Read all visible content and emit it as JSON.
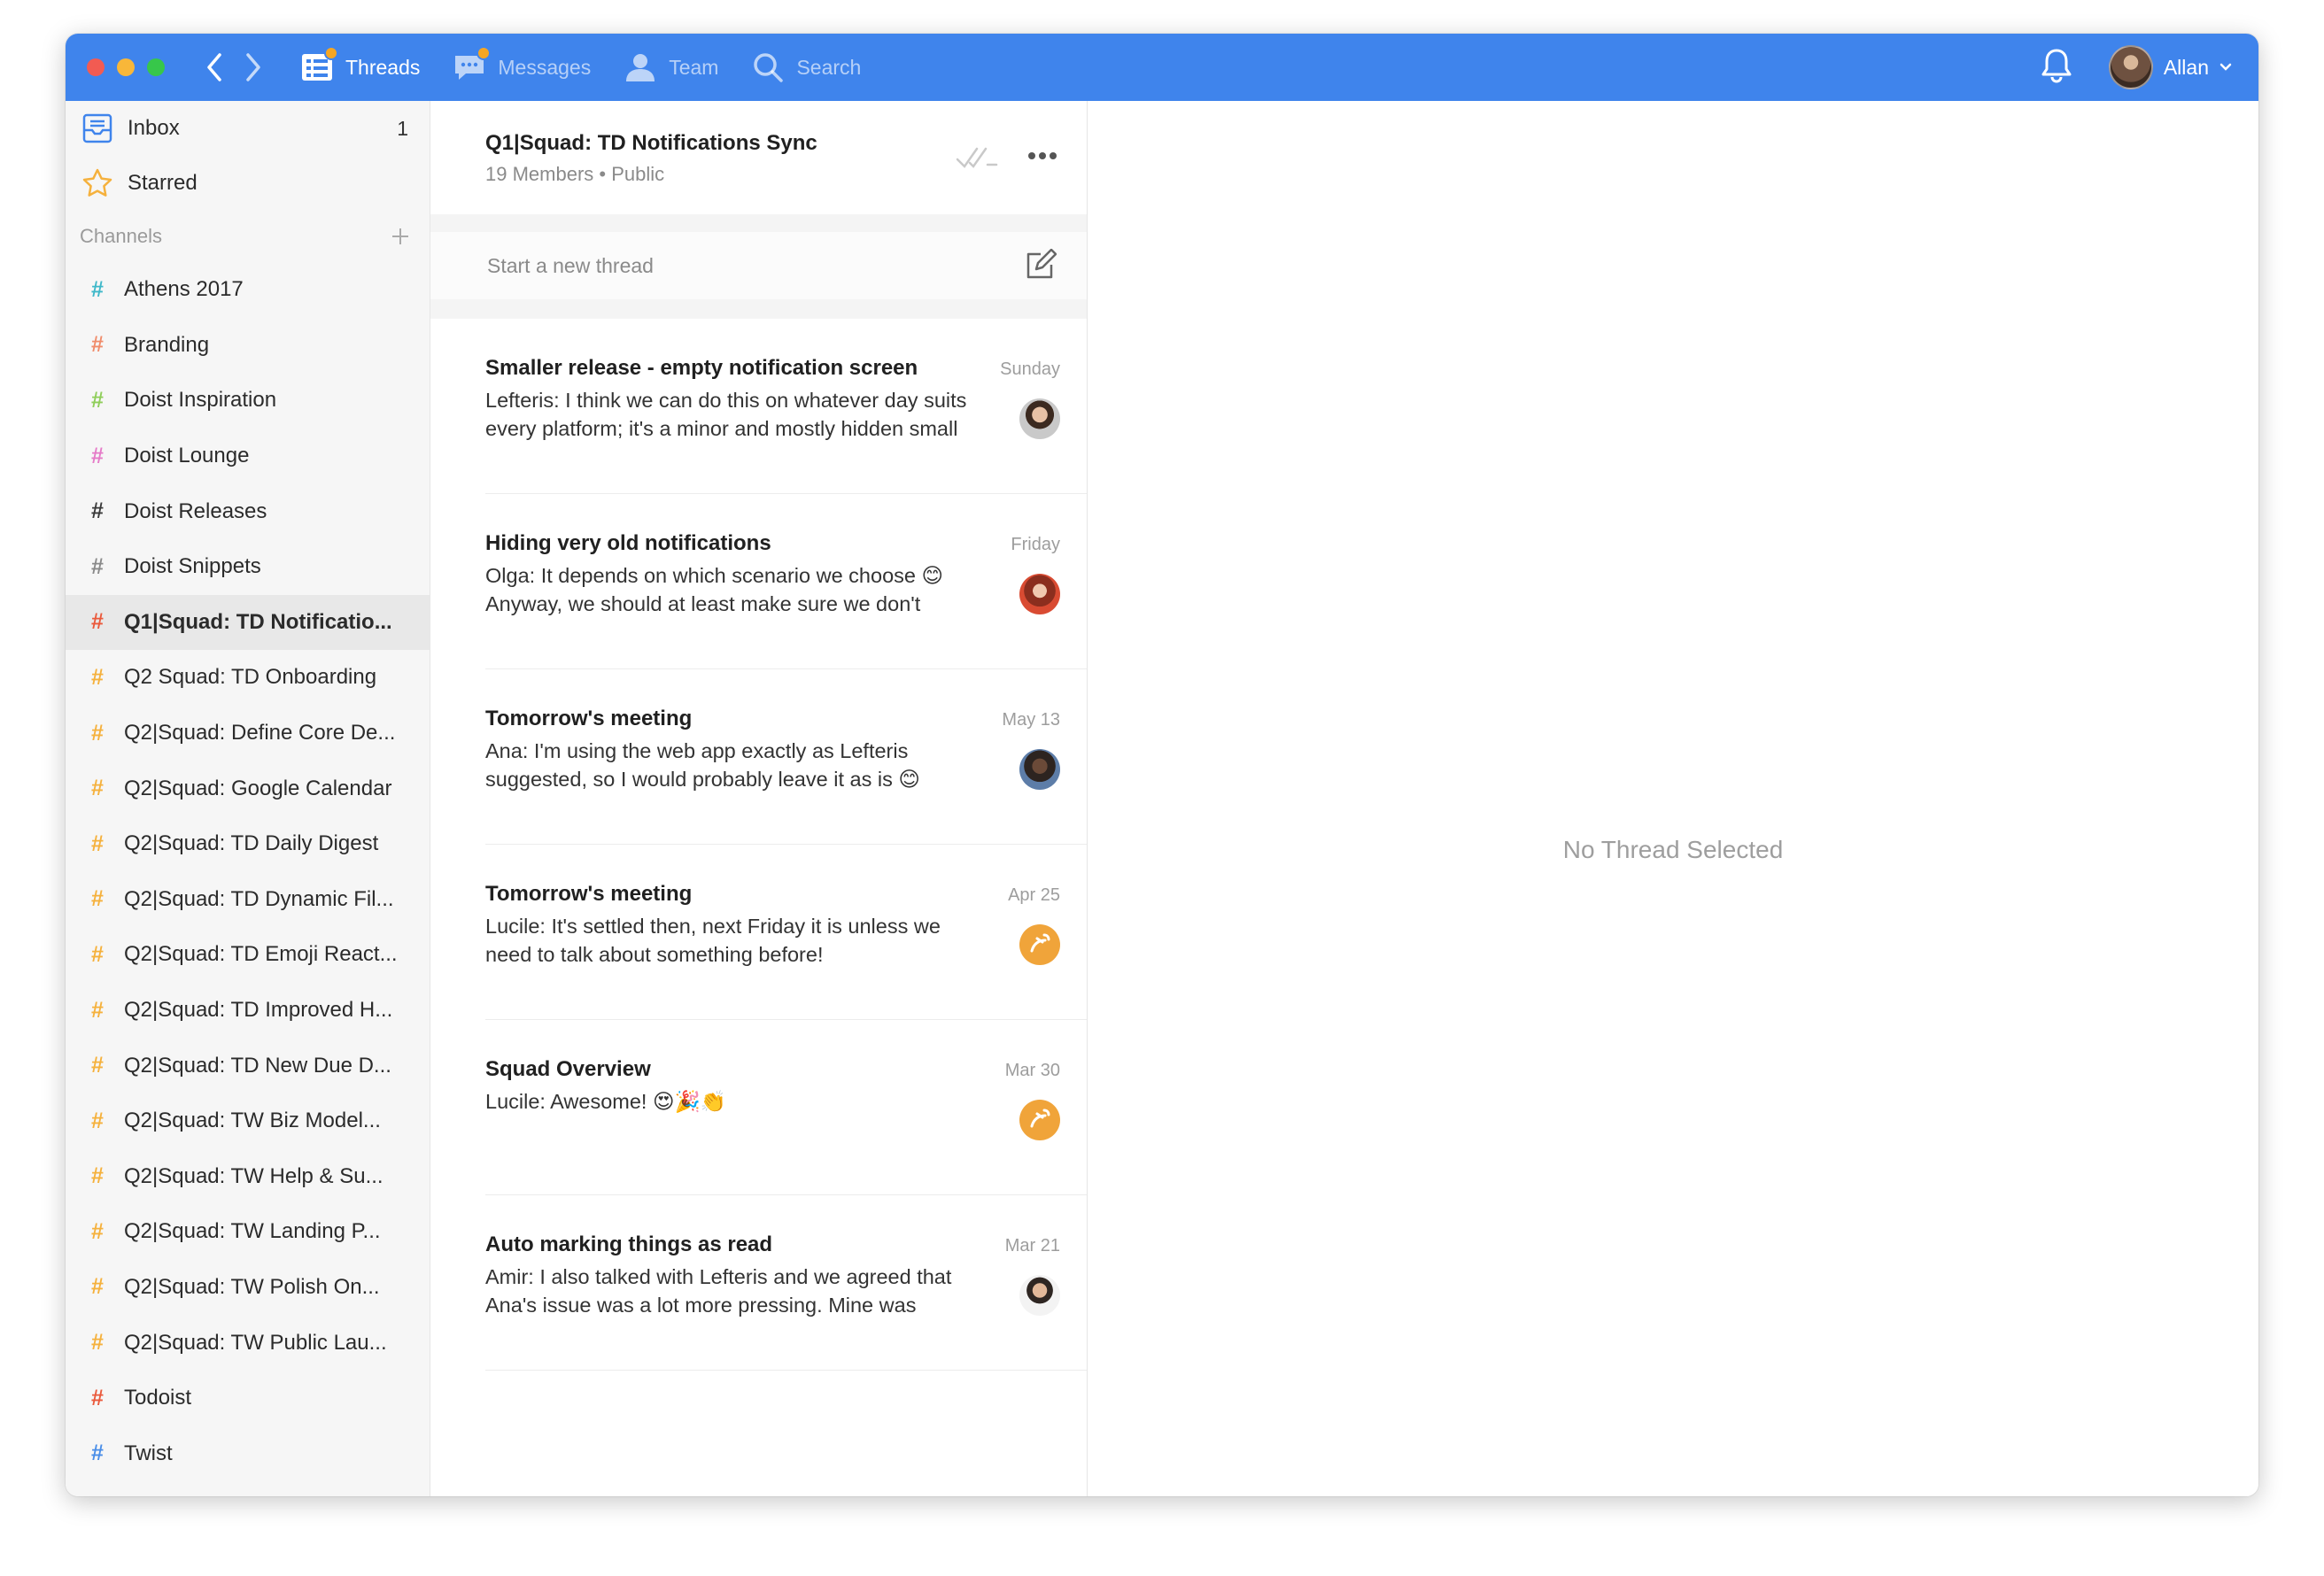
{
  "topbar": {
    "tabs": [
      {
        "label": "Threads",
        "icon": "threads-icon",
        "active": true,
        "badge": true
      },
      {
        "label": "Messages",
        "icon": "messages-icon",
        "active": false,
        "badge": true
      },
      {
        "label": "Team",
        "icon": "team-icon",
        "active": false,
        "badge": false
      },
      {
        "label": "Search",
        "icon": "search-icon",
        "active": false,
        "badge": false
      }
    ],
    "user": {
      "name": "Allan"
    },
    "color": "#3f84ec",
    "badge_color": "#f5a623"
  },
  "sidebar": {
    "inbox": {
      "label": "Inbox",
      "count": "1"
    },
    "starred": {
      "label": "Starred"
    },
    "channels_header": "Channels",
    "channels": [
      {
        "name": "Athens 2017",
        "color": "#3fb8c9"
      },
      {
        "name": "Branding",
        "color": "#f08c6b"
      },
      {
        "name": "Doist Inspiration",
        "color": "#8fce5a"
      },
      {
        "name": "Doist Lounge",
        "color": "#e57bc8"
      },
      {
        "name": "Doist Releases",
        "color": "#3a3a3a"
      },
      {
        "name": "Doist Snippets",
        "color": "#8a8a8a"
      },
      {
        "name": "Q1|Squad: TD Notificatio...",
        "color": "#ea5a3c",
        "selected": true
      },
      {
        "name": "Q2 Squad: TD Onboarding",
        "color": "#f5b13d"
      },
      {
        "name": "Q2|Squad: Define Core De...",
        "color": "#f5b13d"
      },
      {
        "name": "Q2|Squad: Google Calendar",
        "color": "#f5b13d"
      },
      {
        "name": "Q2|Squad: TD Daily Digest",
        "color": "#f5b13d"
      },
      {
        "name": "Q2|Squad: TD Dynamic Fil...",
        "color": "#f5b13d"
      },
      {
        "name": "Q2|Squad: TD Emoji React...",
        "color": "#f5b13d"
      },
      {
        "name": "Q2|Squad: TD Improved H...",
        "color": "#f5b13d"
      },
      {
        "name": "Q2|Squad: TD New Due D...",
        "color": "#f5b13d"
      },
      {
        "name": "Q2|Squad: TW Biz Model...",
        "color": "#f5b13d"
      },
      {
        "name": "Q2|Squad: TW Help & Su...",
        "color": "#f5b13d"
      },
      {
        "name": "Q2|Squad: TW Landing P...",
        "color": "#f5b13d"
      },
      {
        "name": "Q2|Squad: TW Polish On...",
        "color": "#f5b13d"
      },
      {
        "name": "Q2|Squad: TW Public Lau...",
        "color": "#f5b13d"
      },
      {
        "name": "Todoist",
        "color": "#ea5a3c"
      },
      {
        "name": "Twist",
        "color": "#4a8ee8"
      }
    ]
  },
  "channel": {
    "title": "Q1|Squad: TD Notifications Sync",
    "meta": "19 Members • Public",
    "new_thread_placeholder": "Start a new thread"
  },
  "threads": [
    {
      "title": "Smaller release - empty notification screen",
      "date": "Sunday",
      "line1": "Lefteris: I think we can do this on whatever day suits",
      "line2": "every platform; it's a minor and mostly hidden small",
      "avatar": "av-lefteris"
    },
    {
      "title": "Hiding very old notifications",
      "date": "Friday",
      "line1": "Olga: It depends on which scenario we choose 😊",
      "line2": "Anyway, we should at least make sure we don't",
      "avatar": "av-olga"
    },
    {
      "title": "Tomorrow's meeting",
      "date": "May 13",
      "line1": "Ana: I'm using the web app exactly as Lefteris",
      "line2": "suggested, so I would probably leave it as is 😊",
      "avatar": "av-ana"
    },
    {
      "title": "Tomorrow's meeting",
      "date": "Apr 25",
      "line1": "Lucile: It's settled then, next Friday it is unless we",
      "line2": "need to talk about something before!",
      "avatar": "av-lucile"
    },
    {
      "title": "Squad Overview",
      "date": "Mar 30",
      "line1": "Lucile: Awesome! 😍🎉👏",
      "line2": "",
      "avatar": "av-lucile"
    },
    {
      "title": "Auto marking things as read",
      "date": "Mar 21",
      "line1": "Amir: I also talked with Lefteris and we agreed that",
      "line2": "Ana's issue was a lot more pressing. Mine was",
      "avatar": "av-amir"
    }
  ],
  "detail": {
    "empty_message": "No Thread Selected"
  }
}
